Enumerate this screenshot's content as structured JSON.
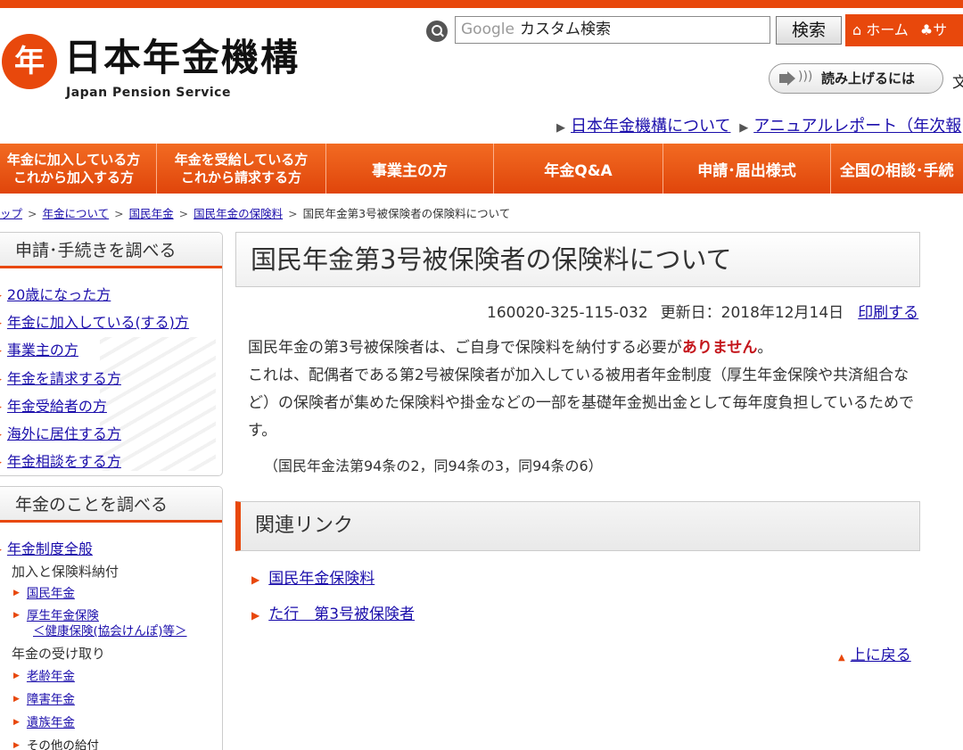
{
  "header": {
    "logo_text": "日本年金機構",
    "logo_mark": "年",
    "logo_sub": "Japan Pension Service",
    "search_brand": "Google",
    "search_placeholder": "カスタム検索",
    "search_button": "検索",
    "home_link": "ホーム",
    "sitemap_link": "サ",
    "read_aloud": "読み上げるには",
    "font_size_label": "文",
    "top_links": [
      "日本年金機構について",
      "アニュアルレポート（年次報"
    ]
  },
  "gnav": {
    "items": [
      {
        "line1": "年金に加入している方",
        "line2": "これから加入する方"
      },
      {
        "line1": "年金を受給している方",
        "line2": "これから請求する方"
      },
      {
        "label": "事業主の方"
      },
      {
        "label": "年金Q&A"
      },
      {
        "label": "申請･届出様式"
      },
      {
        "label": "全国の相談･手続"
      }
    ]
  },
  "breadcrumb": {
    "items": [
      "ップ",
      "年金について",
      "国民年金",
      "国民年金の保険料"
    ],
    "current": "国民年金第3号被保険者の保険料について",
    "separator": ">"
  },
  "sidebar": {
    "box1": {
      "title": "申請･手続きを調べる",
      "items": [
        "20歳になった方",
        "年金に加入している(する)方",
        "事業主の方",
        "年金を請求する方",
        "年金受給者の方",
        "海外に居住する方",
        "年金相談をする方"
      ]
    },
    "box2": {
      "title": "年金のことを調べる",
      "top_item": "年金制度全般",
      "group1": "加入と保険料納付",
      "group1_items": [
        "国民年金",
        "厚生年金保険",
        "＜健康保険(協会けんぽ)等＞"
      ],
      "group2": "年金の受け取り",
      "group2_items": [
        "老齢年金",
        "障害年金",
        "遺族年金",
        "その他の給付"
      ]
    }
  },
  "main": {
    "title": "国民年金第3号被保険者の保険料について",
    "doc_id": "160020-325-115-032",
    "updated": "更新日：2018年12月14日",
    "print": "印刷する",
    "para1_a": "国民年金の第3号被保険者は、ご自身で保険料を納付する必要が",
    "para1_emph": "ありません",
    "para1_b": "。",
    "para2": "これは、配偶者である第2号被保険者が加入している被用者年金制度（厚生年金保険や共済組合など）の保険者が集めた保険料や掛金などの一部を基礎年金拠出金として毎年度負担しているためです。",
    "law_note": "（国民年金法第94条の2，同94条の3，同94条の6）",
    "related_title": "関連リンク",
    "related_links": [
      "国民年金保険料",
      "た行　第3号被保険者"
    ],
    "back_to_top": "上に戻る"
  },
  "colors": {
    "brand_orange": "#e8480c",
    "link_blue": "#1a0dab",
    "emphasis_red": "#c4161c"
  }
}
